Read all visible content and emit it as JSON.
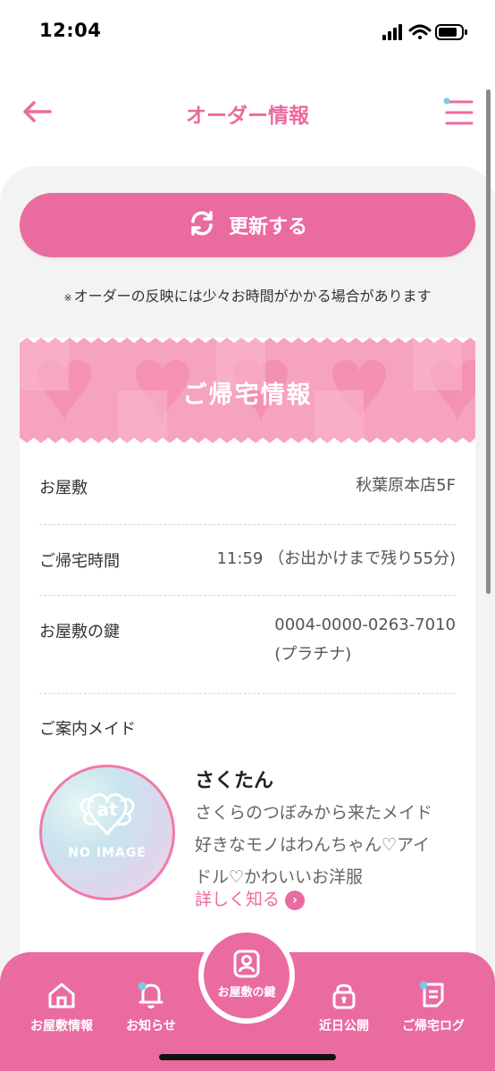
{
  "status_bar": {
    "time": "12:04"
  },
  "header": {
    "title": "オーダー情報"
  },
  "refresh_button": {
    "label": "更新する"
  },
  "notice": {
    "mark": "※",
    "text": "オーダーの反映には少々お時間がかかる場合があります"
  },
  "home_info": {
    "banner_title": "ご帰宅情報",
    "rows": [
      {
        "label": "お屋敷",
        "value": "秋葉原本店5F"
      },
      {
        "label": "ご帰宅時間",
        "value": "11:59 （お出かけまで残り55分)"
      },
      {
        "label": "お屋敷の鍵",
        "value_line1": "0004-0000-0263-7010",
        "value_line2": "(プラチナ)"
      }
    ]
  },
  "guide_maid": {
    "label": "ご案内メイド",
    "avatar_text": "NO IMAGE",
    "avatar_logo": "at",
    "name": "さくたん",
    "desc_lines": [
      "さくらのつぼみから来たメイド",
      "好きなモノはわんちゃん♡アイ",
      "ドル♡かわいいお洋服"
    ],
    "detail_link": "詳しく知る"
  },
  "tabbar": {
    "tabs": [
      {
        "label": "お屋敷情報",
        "icon": "home-icon"
      },
      {
        "label": "お知らせ",
        "icon": "bell-icon"
      },
      {
        "label": "お屋敷の鍵",
        "icon": "user-card-icon"
      },
      {
        "label": "近日公開",
        "icon": "lock-icon"
      },
      {
        "label": "ご帰宅ログ",
        "icon": "log-icon"
      }
    ]
  },
  "colors": {
    "accent": "#ea6ba0",
    "background": "#f3f3f3",
    "notification_dot": "#7ec8e3"
  }
}
